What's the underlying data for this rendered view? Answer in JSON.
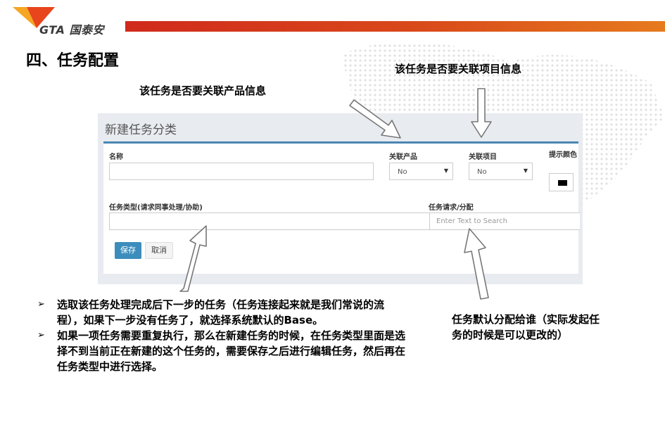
{
  "brand": {
    "logo_text": "GTA 国泰安"
  },
  "slide": {
    "title": "四、任务配置"
  },
  "callouts": {
    "product": "该任务是否要关联产品信息",
    "project": "该任务是否要关联项目信息"
  },
  "form": {
    "title": "新建任务分类",
    "name_label": "名称",
    "product_label": "关联产品",
    "product_value": "No",
    "project_label": "关联项目",
    "project_value": "No",
    "color_label": "提示颜色",
    "type_label": "任务类型(请求同事处理/协助)",
    "assign_label": "任务请求/分配",
    "assign_placeholder": "Enter Text to Search",
    "save_label": "保存",
    "cancel_label": "取消"
  },
  "notes": {
    "bullet1": "选取该任务处理完成后下一步的任务（任务连接起来就是我们常说的流程），如果下一步没有任务了，就选择系统默认的Base。",
    "bullet2": "如果一项任务需要重复执行，那么在新建任务的时候，在任务类型里面是选择不到当前正在新建的这个任务的，需要保存之后进行编辑任务，然后再在任务类型中进行选择。",
    "assign_note": "任务默认分配给谁（实际发起任务的时候是可以更改的）"
  },
  "icons": [
    "bullet-arrow-icon",
    "chevron-down-icon",
    "callout-arrow-icon"
  ],
  "colors": {
    "accent": "#3c8dbc",
    "brand_red": "#d02a1c",
    "brand_orange": "#f5a623"
  }
}
